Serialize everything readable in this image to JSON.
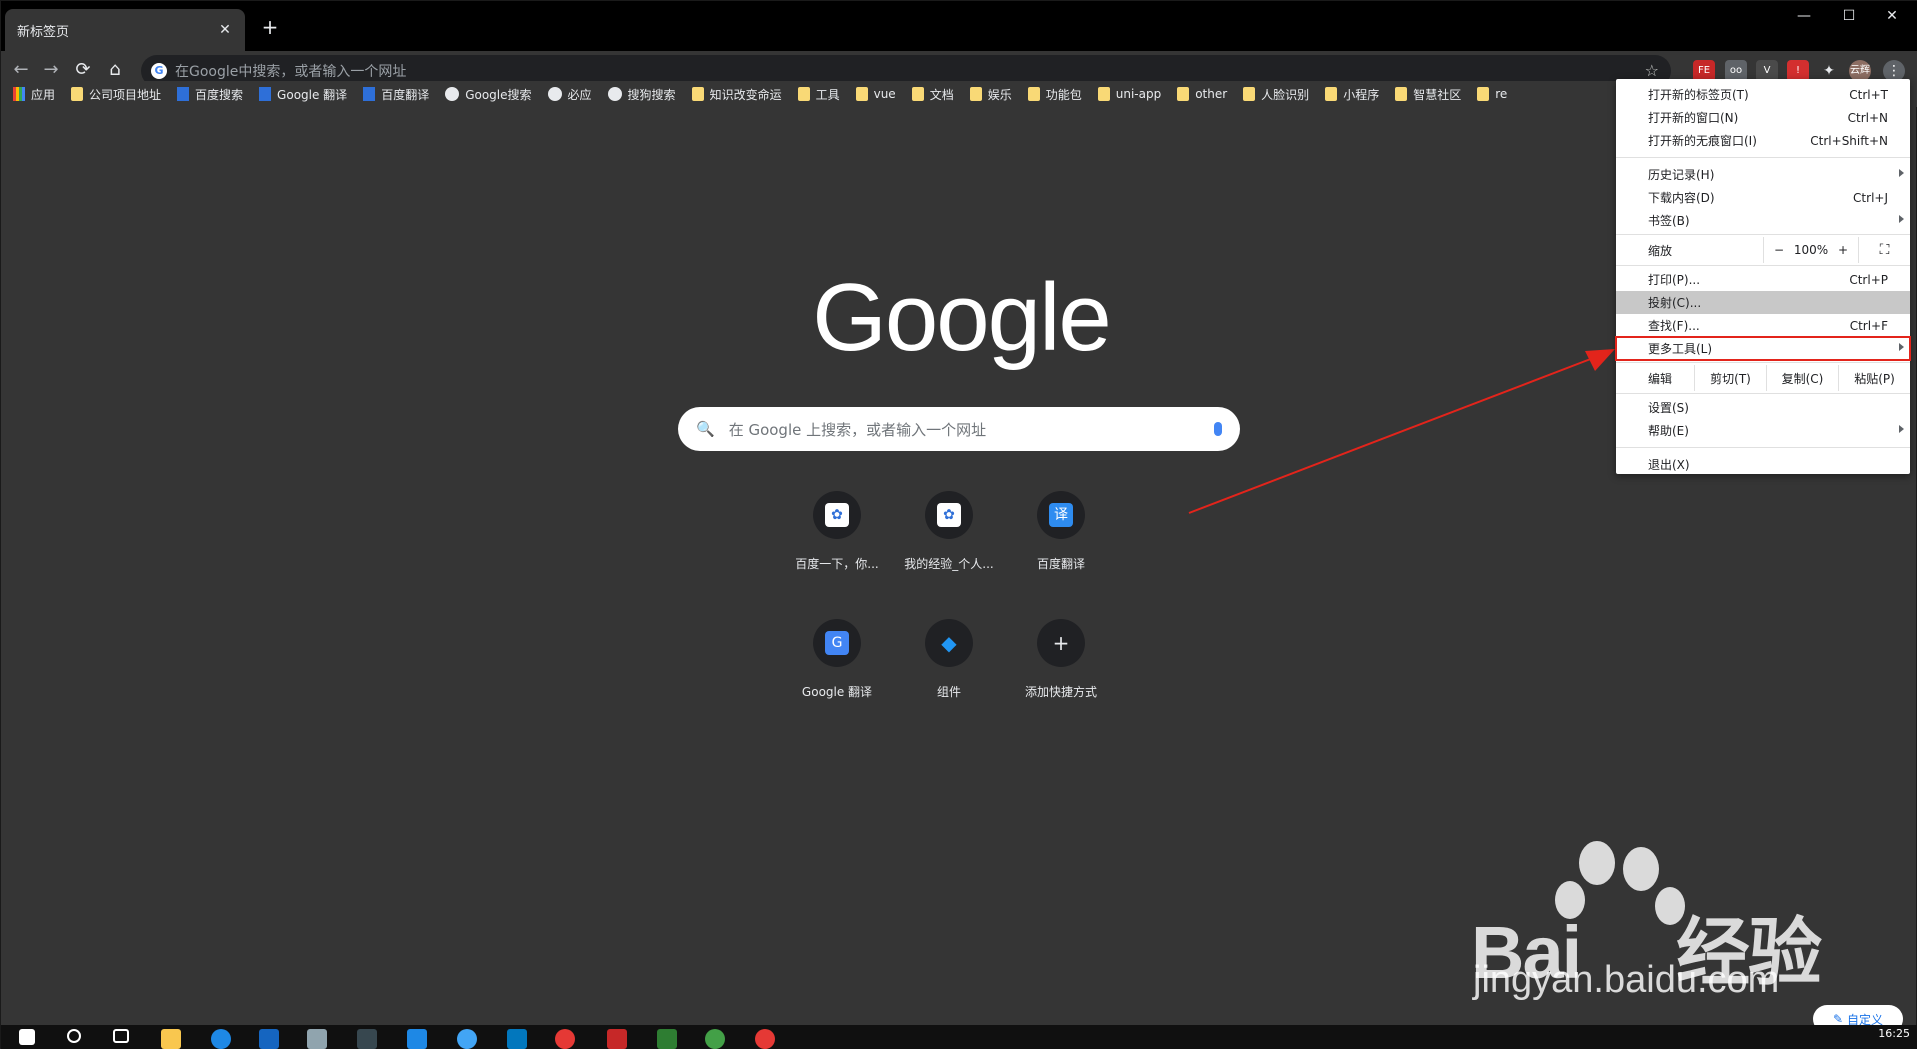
{
  "tab": {
    "title": "新标签页",
    "close": "✕",
    "new_tab": "+"
  },
  "window_controls": {
    "minimize": "—",
    "maximize": "☐",
    "close": "✕"
  },
  "toolbar": {
    "back": "←",
    "forward": "→",
    "reload": "⟳",
    "home": "⌂",
    "omnibox_placeholder": "在Google中搜索，或者输入一个网址",
    "star": "☆",
    "extensions": [
      "FE",
      "oo",
      "V",
      "!",
      "✦"
    ],
    "profile": "云辉",
    "menu": "⋮"
  },
  "bookmarks": [
    {
      "label": "应用",
      "icon": "apps-icon"
    },
    {
      "label": "公司项目地址",
      "icon": "folder-icon"
    },
    {
      "label": "百度搜索",
      "icon": "baidu-icon"
    },
    {
      "label": "Google 翻译",
      "icon": "google-translate-icon"
    },
    {
      "label": "百度翻译",
      "icon": "baidu-translate-icon"
    },
    {
      "label": "Google搜索",
      "icon": "globe-icon"
    },
    {
      "label": "必应",
      "icon": "globe-icon"
    },
    {
      "label": "搜狗搜索",
      "icon": "globe-icon"
    },
    {
      "label": "知识改变命运",
      "icon": "folder-icon"
    },
    {
      "label": "工具",
      "icon": "folder-icon"
    },
    {
      "label": "vue",
      "icon": "folder-icon"
    },
    {
      "label": "文档",
      "icon": "folder-icon"
    },
    {
      "label": "娱乐",
      "icon": "folder-icon"
    },
    {
      "label": "功能包",
      "icon": "folder-icon"
    },
    {
      "label": "uni-app",
      "icon": "folder-icon"
    },
    {
      "label": "other",
      "icon": "folder-icon"
    },
    {
      "label": "人脸识别",
      "icon": "folder-icon"
    },
    {
      "label": "小程序",
      "icon": "folder-icon"
    },
    {
      "label": "智慧社区",
      "icon": "folder-icon"
    },
    {
      "label": "re",
      "icon": "folder-icon"
    }
  ],
  "ntp": {
    "logo": "Google",
    "search_placeholder": "在 Google 上搜索，或者输入一个网址",
    "tiles": [
      {
        "label": "百度一下，你...",
        "icon": "baidu-icon"
      },
      {
        "label": "我的经验_个人...",
        "icon": "baidu-icon"
      },
      {
        "label": "百度翻译",
        "icon": "baidu-translate-icon",
        "glyph": "译"
      },
      {
        "label": "Google 翻译",
        "icon": "google-translate-icon",
        "glyph": "G"
      },
      {
        "label": "组件",
        "icon": "component-icon",
        "glyph": "◆"
      },
      {
        "label": "添加快捷方式",
        "icon": "add-icon",
        "glyph": "+"
      }
    ],
    "customize": "自定义"
  },
  "menu": {
    "new_tab": {
      "label": "打开新的标签页(T)",
      "shortcut": "Ctrl+T"
    },
    "new_window": {
      "label": "打开新的窗口(N)",
      "shortcut": "Ctrl+N"
    },
    "new_incognito": {
      "label": "打开新的无痕窗口(I)",
      "shortcut": "Ctrl+Shift+N"
    },
    "history": {
      "label": "历史记录(H)"
    },
    "downloads": {
      "label": "下载内容(D)",
      "shortcut": "Ctrl+J"
    },
    "bookmarks": {
      "label": "书签(B)"
    },
    "zoom": {
      "label": "缩放",
      "minus": "−",
      "value": "100%",
      "plus": "+",
      "fullscreen": "⛶"
    },
    "print": {
      "label": "打印(P)...",
      "shortcut": "Ctrl+P"
    },
    "cast": {
      "label": "投射(C)..."
    },
    "find": {
      "label": "查找(F)...",
      "shortcut": "Ctrl+F"
    },
    "more_tools": {
      "label": "更多工具(L)"
    },
    "edit": {
      "label": "编辑",
      "cut": "剪切(T)",
      "copy": "复制(C)",
      "paste": "粘贴(P)"
    },
    "settings": {
      "label": "设置(S)"
    },
    "help": {
      "label": "帮助(E)"
    },
    "exit": {
      "label": "退出(X)"
    }
  },
  "watermark": {
    "brand": "Bai",
    "brand2": "经验",
    "url": "jingyan.baidu.com"
  },
  "taskbar": {
    "clock": "16:25"
  },
  "colors": {
    "annotation": "#e3241b",
    "accent": "#1a73e8"
  }
}
